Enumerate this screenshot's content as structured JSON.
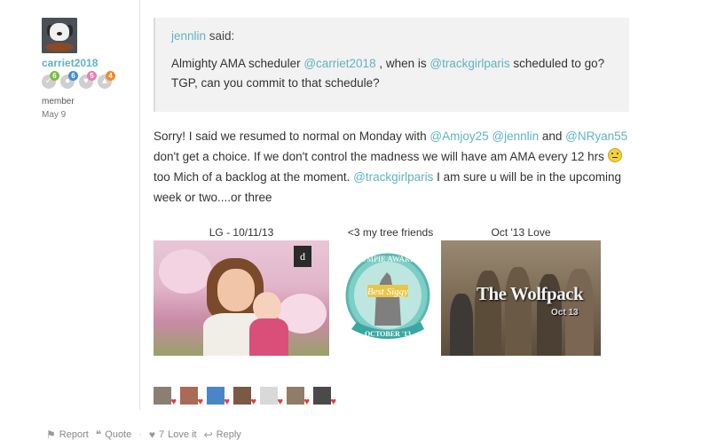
{
  "author": {
    "username": "carriet2018",
    "role": "member",
    "date": "May 9",
    "badges": [
      {
        "icon": "check-badge-icon",
        "count": "6",
        "color": "#7cbc3f"
      },
      {
        "icon": "comment-badge-icon",
        "count": "6",
        "color": "#3f8fd0"
      },
      {
        "icon": "heart-badge-icon",
        "count": "5",
        "color": "#e57fb0"
      },
      {
        "icon": "baby-carriage-badge-icon",
        "count": "4",
        "color": "#f08a2a"
      }
    ]
  },
  "quote": {
    "author": "jennlin",
    "said": "said:",
    "segments": [
      {
        "text": "Almighty AMA scheduler ",
        "link": false
      },
      {
        "text": "@carriet2018",
        "link": true
      },
      {
        "text": " , when is ",
        "link": false
      },
      {
        "text": "@trackgirlparis",
        "link": true
      },
      {
        "text": " scheduled to go? TGP, can you commit to that schedule?",
        "link": false
      }
    ]
  },
  "post": {
    "p1": "Sorry! I said we resumed to normal on Monday with ",
    "m1": "@Amjoy25",
    "m2": "@jennlin",
    "p2": " and ",
    "m3": "@NRyan55",
    "p3": " don't get a choice. If we don't control the madness we will have am AMA every 12 hrs ",
    "p4": " too Mich of a backlog at the moment. ",
    "m4": "@trackgirlparis",
    "p5": " I am sure u will be in the upcoming week or two....or three"
  },
  "signature": {
    "captions": [
      "LG - 10/11/13",
      "<3 my tree friends",
      "Oct '13 Love"
    ],
    "award": {
      "top": "BUMPIE AWARDS",
      "center": "Best Siggy",
      "bottom": "OCTOBER '13"
    },
    "wolfpack_title": "The Wolfpack",
    "wolfpack_sub": "Oct 13"
  },
  "likers": [
    {
      "bg": "#8a7f73"
    },
    {
      "bg": "#a86b55"
    },
    {
      "bg": "#4a86c7"
    },
    {
      "bg": "#7a5a45"
    },
    {
      "bg": "#d9d9d9"
    },
    {
      "bg": "#8f7d68"
    },
    {
      "bg": "#4a4a4a"
    }
  ],
  "actions": {
    "report": "Report",
    "quote": "Quote",
    "love_count": "7",
    "love_label": "Love it",
    "reply": "Reply",
    "sep": "·"
  }
}
